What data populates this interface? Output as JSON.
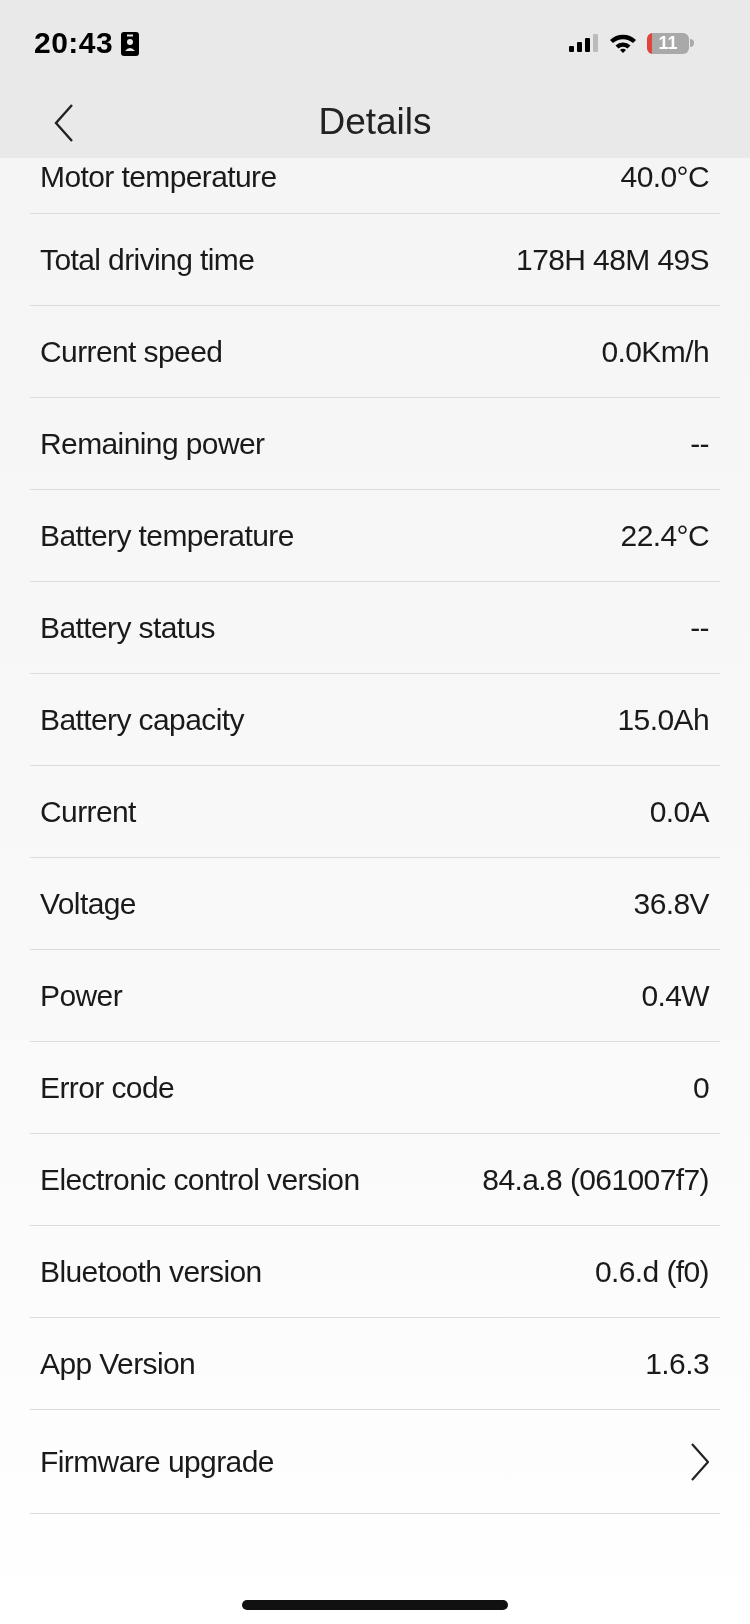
{
  "status_bar": {
    "time": "20:43",
    "battery": "11"
  },
  "header": {
    "title": "Details"
  },
  "rows": [
    {
      "kind": "value",
      "label": "Motor temperature",
      "value": "40.0°C"
    },
    {
      "kind": "value",
      "label": "Total driving time",
      "value": "178H 48M 49S"
    },
    {
      "kind": "value",
      "label": "Current speed",
      "value": "0.0Km/h"
    },
    {
      "kind": "value",
      "label": "Remaining power",
      "value": "--"
    },
    {
      "kind": "value",
      "label": "Battery temperature",
      "value": "22.4°C"
    },
    {
      "kind": "value",
      "label": "Battery status",
      "value": "--"
    },
    {
      "kind": "value",
      "label": "Battery capacity",
      "value": "15.0Ah"
    },
    {
      "kind": "value",
      "label": "Current",
      "value": "0.0A"
    },
    {
      "kind": "value",
      "label": "Voltage",
      "value": "36.8V"
    },
    {
      "kind": "value",
      "label": "Power",
      "value": "0.4W"
    },
    {
      "kind": "value",
      "label": "Error code",
      "value": "0"
    },
    {
      "kind": "value",
      "label": "Electronic control version",
      "value": "84.a.8 (061007f7)"
    },
    {
      "kind": "value",
      "label": "Bluetooth version",
      "value": "0.6.d (f0)"
    },
    {
      "kind": "value",
      "label": "App Version",
      "value": "1.6.3"
    },
    {
      "kind": "link",
      "label": "Firmware upgrade"
    }
  ]
}
